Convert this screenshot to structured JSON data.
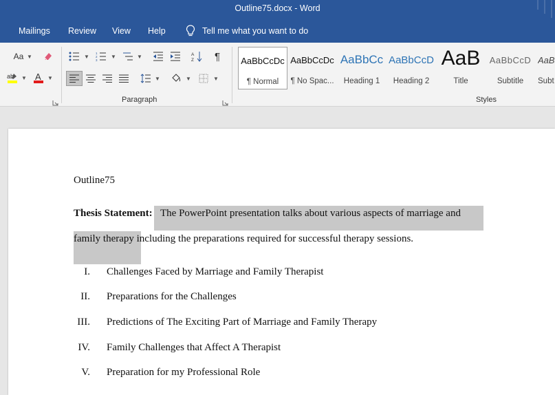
{
  "window": {
    "title": "Outline75.docx  -  Word"
  },
  "tabs": [
    {
      "label": "Mailings"
    },
    {
      "label": "Review"
    },
    {
      "label": "View"
    },
    {
      "label": "Help"
    }
  ],
  "tell_me": {
    "label": "Tell me what you want to do"
  },
  "ribbon": {
    "font_group": {
      "change_case": "Aa"
    },
    "paragraph_group": {
      "label": "Paragraph",
      "show_marks": "¶"
    },
    "styles_group": {
      "label": "Styles"
    },
    "styles": [
      {
        "sample": "AaBbCcDc",
        "name": "¶ Normal"
      },
      {
        "sample": "AaBbCcDc",
        "name": "¶ No Spac..."
      },
      {
        "sample": "AaBbCc",
        "name": "Heading 1"
      },
      {
        "sample": "AaBbCcD",
        "name": "Heading 2"
      },
      {
        "sample": "AaB",
        "name": "Title"
      },
      {
        "sample": "AaBbCcD",
        "name": "Subtitle"
      },
      {
        "sample": "AaBl",
        "name": "Subt"
      }
    ]
  },
  "document": {
    "heading": "Outline75",
    "thesis_label": "Thesis Statement:",
    "thesis_line1": "The PowerPoint presentation talks about various aspects of marriage and",
    "thesis_line2_highlight": "family therapy",
    "thesis_line2_rest": " including the preparations required for successful therapy sessions.",
    "outline": [
      {
        "num": "I.",
        "text": "Challenges Faced by Marriage and Family Therapist"
      },
      {
        "num": "II.",
        "text": "Preparations for the Challenges"
      },
      {
        "num": "III.",
        "text": "Predictions of The Exciting Part of Marriage and Family Therapy"
      },
      {
        "num": "IV.",
        "text": "Family Challenges that Affect A Therapist"
      },
      {
        "num": "V.",
        "text": "Preparation for my Professional Role"
      }
    ]
  },
  "colors": {
    "accent": "#2b579a",
    "highlight": "#c8c8c8",
    "ribbon_bg": "#f3f3f3"
  }
}
